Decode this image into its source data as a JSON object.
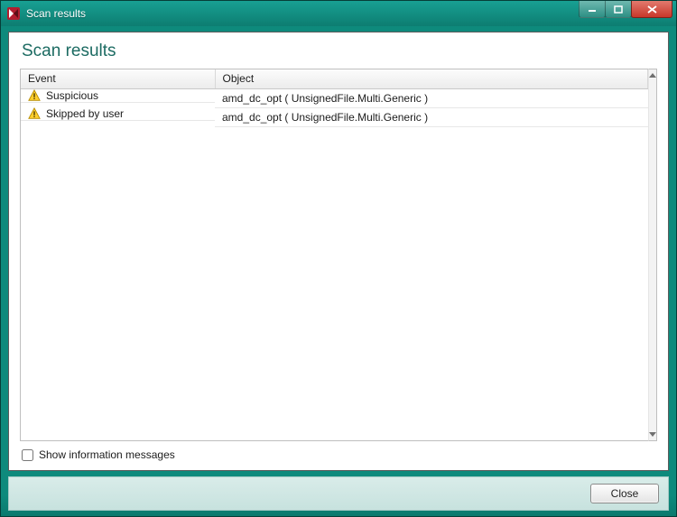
{
  "titlebar": {
    "title": "Scan results"
  },
  "heading": "Scan results",
  "columns": {
    "event": "Event",
    "object": "Object"
  },
  "rows": [
    {
      "event": "Suspicious",
      "object": "amd_dc_opt ( UnsignedFile.Multi.Generic )"
    },
    {
      "event": "Skipped by user",
      "object": "amd_dc_opt ( UnsignedFile.Multi.Generic )"
    }
  ],
  "footer": {
    "show_info_label": "Show information messages"
  },
  "buttons": {
    "close": "Close"
  }
}
